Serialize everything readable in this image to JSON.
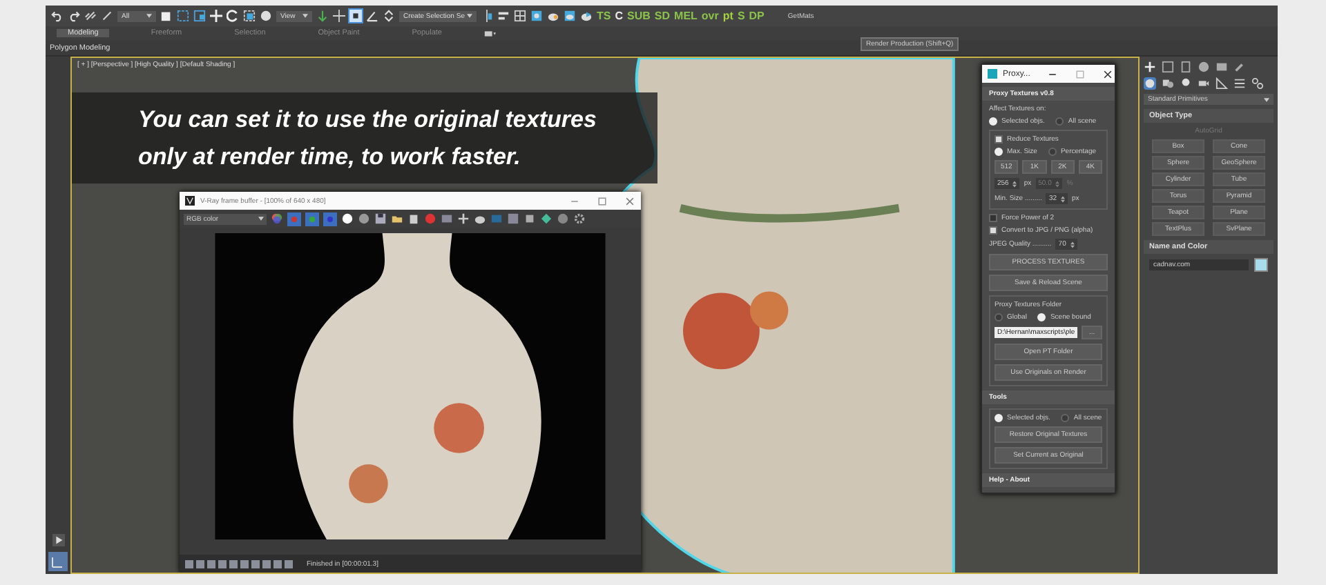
{
  "toolbar": {
    "selection_filter": "All",
    "reference_coordinate": "View",
    "named_selection": "Create Selection Se",
    "plugin_labels": [
      "TS",
      "C",
      "SUB",
      "SD",
      "MEL",
      "ovr",
      "pt",
      "S",
      "DP"
    ],
    "script_button": "GetMats",
    "tooltip": "Render Production   (Shift+Q)"
  },
  "ribbon": {
    "tabs": [
      {
        "label": "Modeling",
        "selected": true
      },
      {
        "label": "Freeform",
        "selected": false
      },
      {
        "label": "Selection",
        "selected": false
      },
      {
        "label": "Object Paint",
        "selected": false
      },
      {
        "label": "Populate",
        "selected": false
      }
    ],
    "panel_label": "Polygon Modeling"
  },
  "viewport": {
    "label": "[ + ] [Perspective ] [High Quality ] [Default Shading ]",
    "caption": "You can set it to use the **original textures only at render time**, to work faster."
  },
  "frame_buffer": {
    "title": "V-Ray frame buffer - [100% of 640 x 480]",
    "channel": "RGB color",
    "status": "Finished in [00:00:01.3]"
  },
  "proxy_panel": {
    "title": "Proxy...",
    "section": "Proxy Textures v0.8",
    "affect_label": "Affect Textures on:",
    "affect_options": [
      {
        "label": "Selected objs.",
        "selected": true
      },
      {
        "label": "All scene",
        "selected": false
      }
    ],
    "reduce": {
      "label": "Reduce Textures",
      "checked": true
    },
    "size_modes": [
      {
        "label": "Max. Size",
        "selected": true
      },
      {
        "label": "Percentage",
        "selected": false
      }
    ],
    "size_buttons": [
      "512",
      "1K",
      "2K",
      "4K"
    ],
    "max_size": {
      "value": "256",
      "unit": "px"
    },
    "percentage": {
      "value": "50.0",
      "unit": "%",
      "disabled": true
    },
    "min_size": {
      "label": "Min. Size .........",
      "value": "32",
      "unit": "px"
    },
    "options": [
      {
        "label": "Force Power of 2",
        "checked": false
      },
      {
        "label": "Convert to JPG / PNG (alpha)",
        "checked": true
      }
    ],
    "jpeg_quality": {
      "label": "JPEG Quality ..........",
      "value": "70"
    },
    "actions": [
      "PROCESS TEXTURES",
      "Save & Reload Scene"
    ],
    "folder_group": "Proxy Textures Folder",
    "folder_options": [
      {
        "label": "Global",
        "selected": false
      },
      {
        "label": "Scene bound",
        "selected": true
      }
    ],
    "folder_path": "D:\\Hernan\\maxscripts\\ple",
    "browse": "...",
    "open_folder": "Open PT Folder",
    "use_originals": "Use Originals on Render",
    "tools_section": "Tools",
    "tools_options": [
      {
        "label": "Selected objs.",
        "selected": true
      },
      {
        "label": "All scene",
        "selected": false
      }
    ],
    "tools_actions": [
      "Restore Original Textures",
      "Set Current as Original"
    ],
    "help_section": "Help - About"
  },
  "command_panel": {
    "category": "Standard Primitives",
    "object_type": "Object Type",
    "autogrid": {
      "label": "AutoGrid",
      "disabled": true
    },
    "primitives": [
      "Box",
      "Cone",
      "Sphere",
      "GeoSphere",
      "Cylinder",
      "Tube",
      "Torus",
      "Pyramid",
      "Teapot",
      "Plane",
      "TextPlus",
      "SvPlane"
    ],
    "name_and_color": "Name and Color",
    "object_name": "cadnav.com",
    "color": "#a8dcec"
  }
}
